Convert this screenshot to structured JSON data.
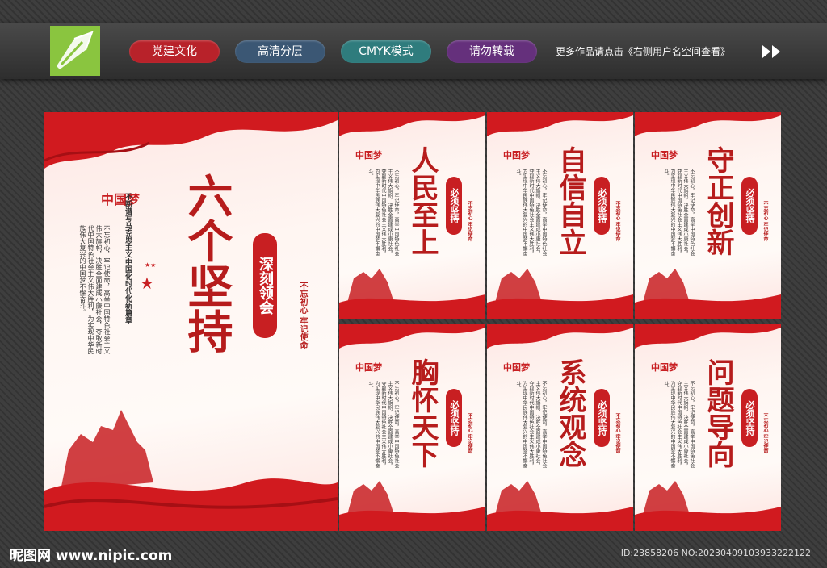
{
  "header": {
    "tags": [
      "党建文化",
      "高清分层",
      "CMYK模式",
      "请勿转载"
    ],
    "notice": "更多作品请点击《右侧用户名空间查看》"
  },
  "main_poster": {
    "title": "六个坚持",
    "badge": "深刻领会",
    "motto": "不忘初心 牢记使命",
    "subtitle": "不断谱写马克思主义中国化时代化新篇章",
    "body": "不忘初心，牢记使命，高举中国特色社会主义伟大旗帜，决胜全面建成小康社会，夺取新时代中国特色社会主义伟大胜利，为实现中华民族伟大复兴的中国梦不懈奋斗。",
    "emblem": "中国梦"
  },
  "small_posters": [
    {
      "title": "人民至上",
      "badge": "必须坚持",
      "motto": "不忘初心 牢记使命"
    },
    {
      "title": "自信自立",
      "badge": "必须坚持",
      "motto": "不忘初心 牢记使命"
    },
    {
      "title": "守正创新",
      "badge": "必须坚持",
      "motto": "不忘初心 牢记使命"
    },
    {
      "title": "胸怀天下",
      "badge": "必须坚持",
      "motto": "不忘初心 牢记使命"
    },
    {
      "title": "系统观念",
      "badge": "必须坚持",
      "motto": "不忘初心 牢记使命"
    },
    {
      "title": "问题导向",
      "badge": "必须坚持",
      "motto": "不忘初心 牢记使命"
    }
  ],
  "footer": {
    "site": "昵图网 www.nipic.com",
    "id": "ID:23858206 NO:20230409103933222122"
  },
  "colors": {
    "red": "#c81f22",
    "dark_red": "#b61c1c"
  }
}
